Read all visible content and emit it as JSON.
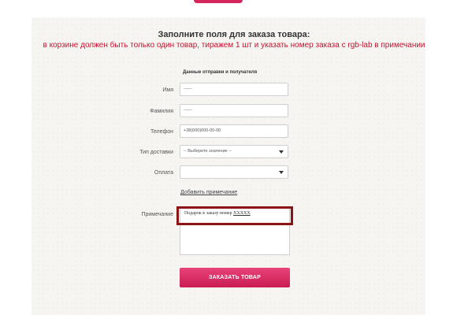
{
  "header": {
    "title": "Заполните поля для заказа товара:",
    "notice": "в корзине должен быть только один товар, тиражем 1 шт и указать номер заказа с rgb-lab в примечании"
  },
  "form": {
    "section_title": "Данные отправки и получателя",
    "fields": {
      "name": {
        "label": "Имя",
        "value": "------"
      },
      "surname": {
        "label": "Фамилия",
        "value": "------"
      },
      "phone": {
        "label": "Телефон",
        "value": "+38(000)000-00-00"
      },
      "delivery": {
        "label": "Тип доставки",
        "value": "-- Выберите значение --"
      },
      "payment": {
        "label": "Оплата",
        "value": ""
      }
    },
    "add_note_link": "Добавить примечание",
    "note": {
      "label": "Примечание",
      "value_prefix": "Подарок к заказу номер ",
      "value_order": "XXXXX"
    },
    "submit_label": "ЗАКАЗАТЬ ТОВАР"
  },
  "colors": {
    "accent": "#d6275c",
    "notice": "#c8102e",
    "highlight_border": "#8b1414"
  }
}
